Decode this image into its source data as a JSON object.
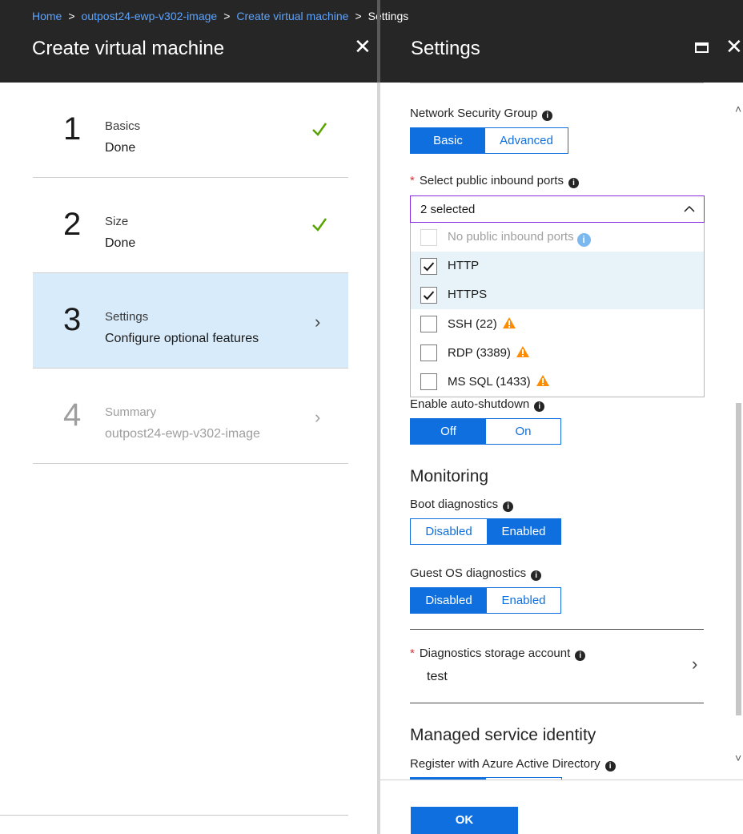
{
  "breadcrumb": {
    "home": "Home",
    "image": "outpost24-ewp-v302-image",
    "create": "Create virtual machine",
    "current": "Settings",
    "separator": ">"
  },
  "left_blade": {
    "title": "Create virtual machine",
    "close": "✕",
    "steps": [
      {
        "number": "1",
        "title": "Basics",
        "subtitle": "Done",
        "status": "done"
      },
      {
        "number": "2",
        "title": "Size",
        "subtitle": "Done",
        "status": "done"
      },
      {
        "number": "3",
        "title": "Settings",
        "subtitle": "Configure optional features",
        "status": "active"
      },
      {
        "number": "4",
        "title": "Summary",
        "subtitle": "outpost24-ewp-v302-image",
        "status": "disabled"
      }
    ],
    "chevron": "›"
  },
  "right_blade": {
    "title": "Settings",
    "close": "✕",
    "nsg": {
      "label": "Network Security Group",
      "options": [
        "Basic",
        "Advanced"
      ],
      "selected": "Basic"
    },
    "inbound_ports": {
      "required_mark": "*",
      "label": "Select public inbound ports",
      "value": "2 selected",
      "chevron": "^",
      "options": [
        {
          "label": "No public inbound ports",
          "checked": false,
          "disabled": true
        },
        {
          "label": "HTTP",
          "checked": true
        },
        {
          "label": "HTTPS",
          "checked": true
        },
        {
          "label": "SSH (22)",
          "checked": false,
          "warning": true
        },
        {
          "label": "RDP (3389)",
          "checked": false,
          "warning": true
        },
        {
          "label": "MS SQL (1433)",
          "checked": false,
          "warning": true
        }
      ]
    },
    "auto_shutdown": {
      "label": "Enable auto-shutdown",
      "options": [
        "Off",
        "On"
      ],
      "selected": "Off"
    },
    "monitoring": {
      "title": "Monitoring",
      "boot_diag": {
        "label": "Boot diagnostics",
        "options": [
          "Disabled",
          "Enabled"
        ],
        "selected": "Enabled"
      },
      "guest_diag": {
        "label": "Guest OS diagnostics",
        "options": [
          "Disabled",
          "Enabled"
        ],
        "selected": "Disabled"
      },
      "storage": {
        "required_mark": "*",
        "label": "Diagnostics storage account",
        "value": "test",
        "chevron": "›"
      }
    },
    "msi": {
      "title": "Managed service identity",
      "register_label": "Register with Azure Active Directory"
    },
    "ok_label": "OK"
  },
  "colors": {
    "accent": "#0f6fde",
    "topbar": "#262626",
    "active_step": "#d8ebfa",
    "success": "#57a300",
    "warning": "#ff8c00",
    "required": "#d13438"
  }
}
